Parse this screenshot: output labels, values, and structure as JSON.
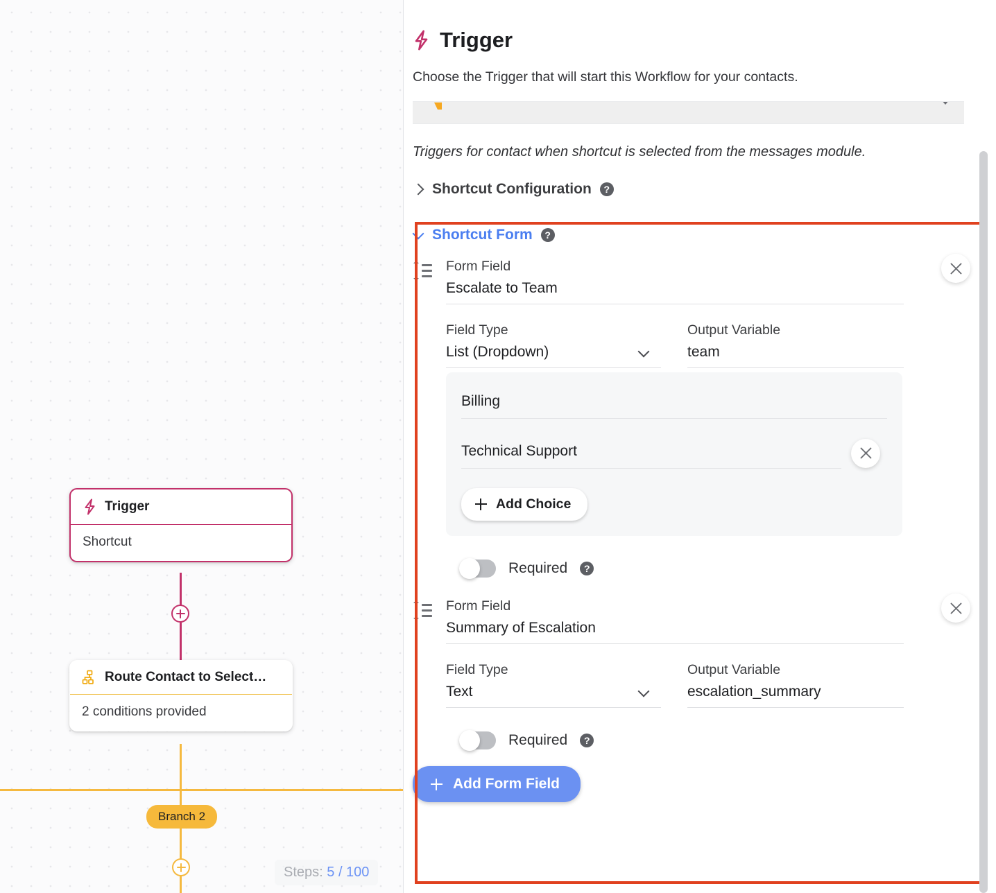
{
  "canvas": {
    "nodes": [
      {
        "id": "trigger",
        "title": "Trigger",
        "subtitle": "Shortcut",
        "icon": "lightning-bolt-icon",
        "accent": "#c2316a",
        "selected": true
      },
      {
        "id": "route-contact",
        "title": "Route Contact to Select…",
        "subtitle": "2 conditions provided",
        "icon": "sitemap-icon",
        "accent": "#f0c14b",
        "selected": false
      }
    ],
    "branch_label": "Branch 2",
    "steps": {
      "prefix": "Steps:",
      "value": "5 / 100"
    },
    "add_node_label": "+"
  },
  "panel": {
    "title": "Trigger",
    "title_icon": "lightning-bolt-icon",
    "subtitle": "Choose the Trigger that will start this Workflow for your contacts.",
    "trigger_select_value": "",
    "description": "Triggers for contact when shortcut is selected from the messages module.",
    "sections": [
      {
        "id": "shortcut-configuration",
        "label": "Shortcut Configuration",
        "expanded": false,
        "help": "?"
      },
      {
        "id": "shortcut-form",
        "label": "Shortcut Form",
        "expanded": true,
        "help": "?"
      }
    ],
    "labels": {
      "form_field": "Form Field",
      "field_type": "Field Type",
      "output_variable": "Output Variable",
      "required": "Required",
      "help": "?"
    },
    "form_fields": [
      {
        "name": "Escalate to Team",
        "field_type": "List (Dropdown)",
        "output_variable": "team",
        "required": false,
        "choices": [
          "Billing",
          "Technical Support"
        ],
        "add_choice_label": "Add Choice"
      },
      {
        "name": "Summary of Escalation",
        "field_type": "Text",
        "output_variable": "escalation_summary",
        "required": false,
        "choices": []
      }
    ],
    "add_form_field_label": "Add Form Field",
    "accent_blue": "#6b91f2",
    "highlight_color": "#e0411f"
  }
}
